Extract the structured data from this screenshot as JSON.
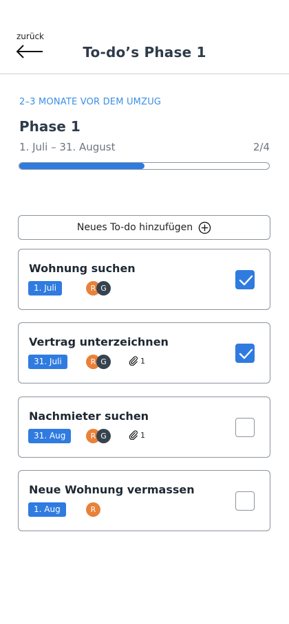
{
  "header": {
    "back_label": "zurück",
    "title": "To-do’s Phase 1"
  },
  "phase": {
    "kicker": "2–3 MONATE VOR DEM UMZUG",
    "title": "Phase 1",
    "dates": "1. Juli – 31. August",
    "count": "2/4",
    "progress": 0.5
  },
  "add_button": {
    "label": "Neues To-do hinzufügen"
  },
  "todos": [
    {
      "title": "Wohnung suchen",
      "date": "1. Juli",
      "avatars": [
        "R",
        "G"
      ],
      "attachments": "",
      "checked": true
    },
    {
      "title": "Vertrag unterzeichnen",
      "date": "31. Juli",
      "avatars": [
        "R",
        "G"
      ],
      "attachments": "1",
      "checked": true
    },
    {
      "title": "Nachmieter suchen",
      "date": "31. Aug",
      "avatars": [
        "R",
        "G"
      ],
      "attachments": "1",
      "checked": false
    },
    {
      "title": "Neue Wohnung vermassen",
      "date": "1. Aug",
      "avatars": [
        "R"
      ],
      "attachments": "",
      "checked": false
    }
  ],
  "colors": {
    "accent": "#2f7be0",
    "kicker": "#3a8ee6",
    "avatar_r": "#e8813a",
    "avatar_g": "#36434f"
  }
}
